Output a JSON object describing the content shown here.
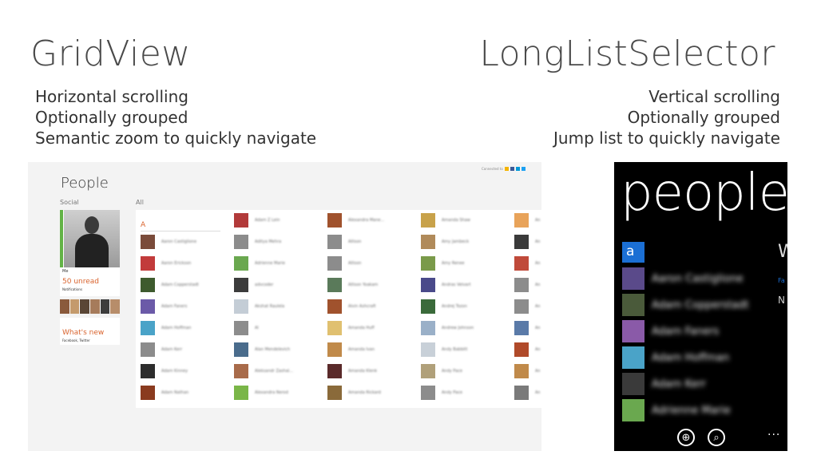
{
  "left": {
    "title": "GridView",
    "features": [
      "Horizontal scrolling",
      "Optionally grouped",
      "Semantic zoom to quickly navigate"
    ]
  },
  "right": {
    "title": "LongListSelector",
    "features": [
      "Vertical scrolling",
      "Optionally grouped",
      "Jump list to quickly navigate"
    ]
  },
  "win_app": {
    "title": "People",
    "connected_label": "Connected to",
    "connected_colors": [
      "#f4b400",
      "#3b5998",
      "#0099d8",
      "#1da1f2"
    ],
    "social_label": "Social",
    "all_label": "All",
    "me": {
      "name": "Me",
      "unread": "50 unread",
      "notifications": "Notifications",
      "accent": "#63b346"
    },
    "friends_strip_colors": [
      "#8a5a3c",
      "#c49a6c",
      "#5a4636",
      "#a67b5b",
      "#3d3d3d",
      "#b78d6a"
    ],
    "whats_new": "What's new",
    "whats_new_sub": "Facebook, Twitter",
    "group_letter": "A",
    "accent": "#d9632d",
    "columns": [
      [
        {
          "name": "Aaron Castiglione",
          "color": "#7a4b3a"
        },
        {
          "name": "Aaron Erickson",
          "color": "#c23b3b"
        },
        {
          "name": "Adam Copperstadt",
          "color": "#3e5b2e"
        },
        {
          "name": "Adam Faners",
          "color": "#6b5aa8"
        },
        {
          "name": "Adam Hoffman",
          "color": "#4aa3c8"
        },
        {
          "name": "Adam Kerr",
          "color": "#8c8c8c"
        },
        {
          "name": "Adam Kinney",
          "color": "#2d2d2d"
        },
        {
          "name": "Adam Nathan",
          "color": "#8a3b1f"
        }
      ],
      [
        {
          "name": "Adam Z Lein",
          "color": "#b23a3a"
        },
        {
          "name": "Aditya Mehra",
          "color": "#8c8c8c"
        },
        {
          "name": "Adrienne Marie",
          "color": "#6aa84f"
        },
        {
          "name": "advcoder",
          "color": "#3c3c3c"
        },
        {
          "name": "Akshat Raulela",
          "color": "#c4cdd6"
        },
        {
          "name": "Al",
          "color": "#8c8c8c"
        },
        {
          "name": "Alan Mendelevich",
          "color": "#4a6c8c"
        },
        {
          "name": "Aleksandr Zashal...",
          "color": "#a86b4a"
        },
        {
          "name": "Alexandra Nerod",
          "color": "#7ab648"
        }
      ],
      [
        {
          "name": "Alexandra Mane...",
          "color": "#a0522d"
        },
        {
          "name": "Allison",
          "color": "#8c8c8c"
        },
        {
          "name": "Allison",
          "color": "#8c8c8c"
        },
        {
          "name": "Allison Yoakam",
          "color": "#5a7a5a"
        },
        {
          "name": "Alvin Ashcraft",
          "color": "#a0522d"
        },
        {
          "name": "Amanda Huff",
          "color": "#e0c070"
        },
        {
          "name": "Amanda Ivan",
          "color": "#c08a4a"
        },
        {
          "name": "Amanda Klenk",
          "color": "#5a2a2a"
        },
        {
          "name": "Amanda Rickard",
          "color": "#8a6a3a"
        }
      ],
      [
        {
          "name": "Amanda Shaw",
          "color": "#c8a24a"
        },
        {
          "name": "Amy Jambeck",
          "color": "#b08a5a"
        },
        {
          "name": "Amy Renee",
          "color": "#7a9a4a"
        },
        {
          "name": "Andras Velvart",
          "color": "#4a4a8a"
        },
        {
          "name": "Andrej Tozon",
          "color": "#3a6a3a"
        },
        {
          "name": "Andrew Johnson",
          "color": "#9ab0c8"
        },
        {
          "name": "Andy Babbitt",
          "color": "#c8d0d8"
        },
        {
          "name": "Andy Pace",
          "color": "#b0a07a"
        },
        {
          "name": "Andy Pace",
          "color": "#8c8c8c"
        }
      ],
      [
        {
          "name": "An",
          "color": "#e8a35a"
        },
        {
          "name": "An",
          "color": "#3a3a3a"
        },
        {
          "name": "An",
          "color": "#c04a3a"
        },
        {
          "name": "An",
          "color": "#8c8c8c"
        },
        {
          "name": "An",
          "color": "#8c8c8c"
        },
        {
          "name": "An",
          "color": "#5a7aa8"
        },
        {
          "name": "An",
          "color": "#b04a2a"
        },
        {
          "name": "An",
          "color": "#c08a4a"
        },
        {
          "name": "An",
          "color": "#7a7a7a"
        }
      ]
    ]
  },
  "phone": {
    "title": "people",
    "jump_letter": "a",
    "pivot_peek": "W",
    "pivot_link": "Fa",
    "pivot_text": "N",
    "accent": "#1b6fd4",
    "contacts": [
      {
        "name": "Aaron Castiglione",
        "color": "#5a4a8a"
      },
      {
        "name": "Adam Copperstadt",
        "color": "#4a5a3a"
      },
      {
        "name": "Adam Faners",
        "color": "#8a5aa8"
      },
      {
        "name": "Adam Hoffman",
        "color": "#4aa3c8"
      },
      {
        "name": "Adam Kerr",
        "color": "#3a3a3a"
      },
      {
        "name": "Adrienne Marie",
        "color": "#6aa84f"
      }
    ],
    "appbar": {
      "add_icon": "⊕",
      "search_icon": "⌕",
      "more": "..."
    }
  }
}
